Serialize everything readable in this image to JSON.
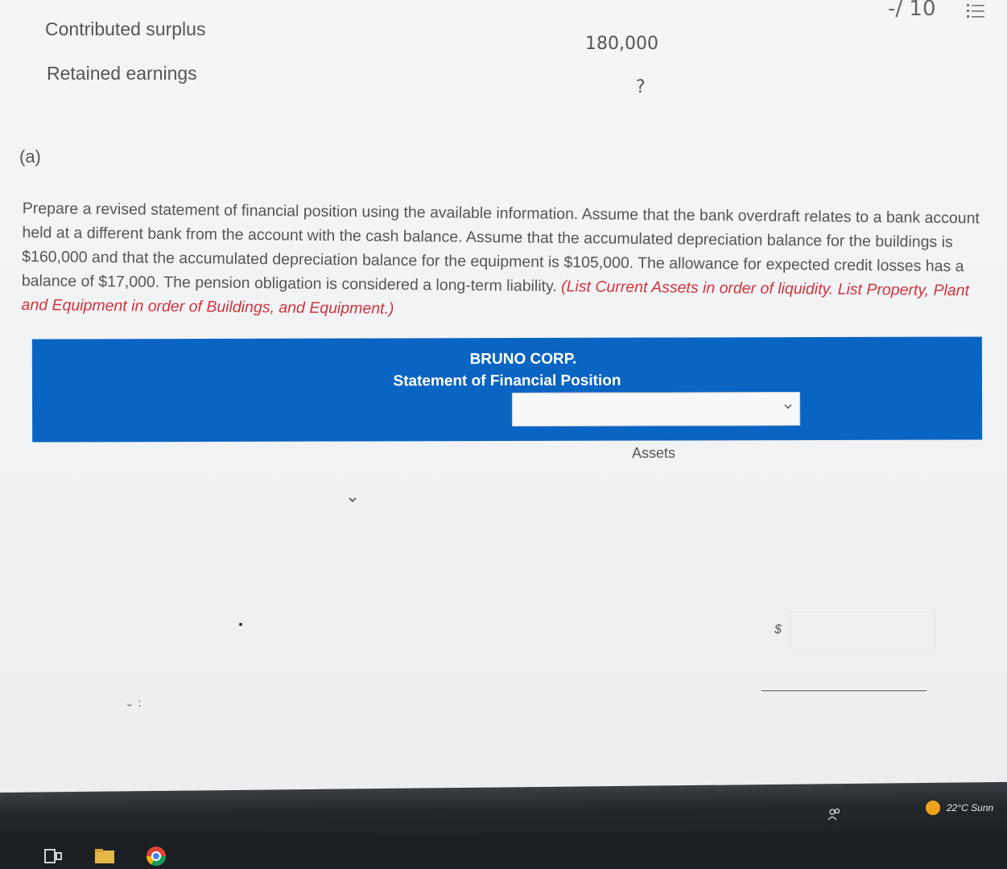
{
  "header": {
    "score": "-/ 10",
    "list_icon": "list-icon"
  },
  "previous_rows": [
    {
      "label": "Contributed surplus",
      "value": "180,000"
    },
    {
      "label": "Retained earnings",
      "value": "?"
    }
  ],
  "question": {
    "part_label": "(a)",
    "instructions_text": "Prepare a revised statement of financial position using the available information. Assume that the bank overdraft relates to a bank account held at a different bank from the account with the cash balance. Assume that the accumulated depreciation balance for the buildings is $160,000 and that the accumulated depreciation balance for the equipment is $105,000. The allowance for expected credit losses has a balance of $17,000. The pension obligation is considered a long-term liability.",
    "instructions_emphasis": "(List Current Assets in order of liquidity. List Property, Plant and Equipment in order of Buildings, and Equipment.)"
  },
  "statement": {
    "company": "BRUNO CORP.",
    "title": "Statement of Financial Position",
    "date_select_value": "",
    "assets_heading": "Assets",
    "currency_symbol": "$",
    "amount_value": ""
  },
  "taskbar": {
    "weather_text": "22°C Sunn",
    "icons": [
      "task-view-icon",
      "file-explorer-icon",
      "chrome-icon",
      "people-icon",
      "sun-icon"
    ]
  },
  "colors": {
    "banner": "#0a64c2",
    "emphasis": "#d0333b"
  }
}
